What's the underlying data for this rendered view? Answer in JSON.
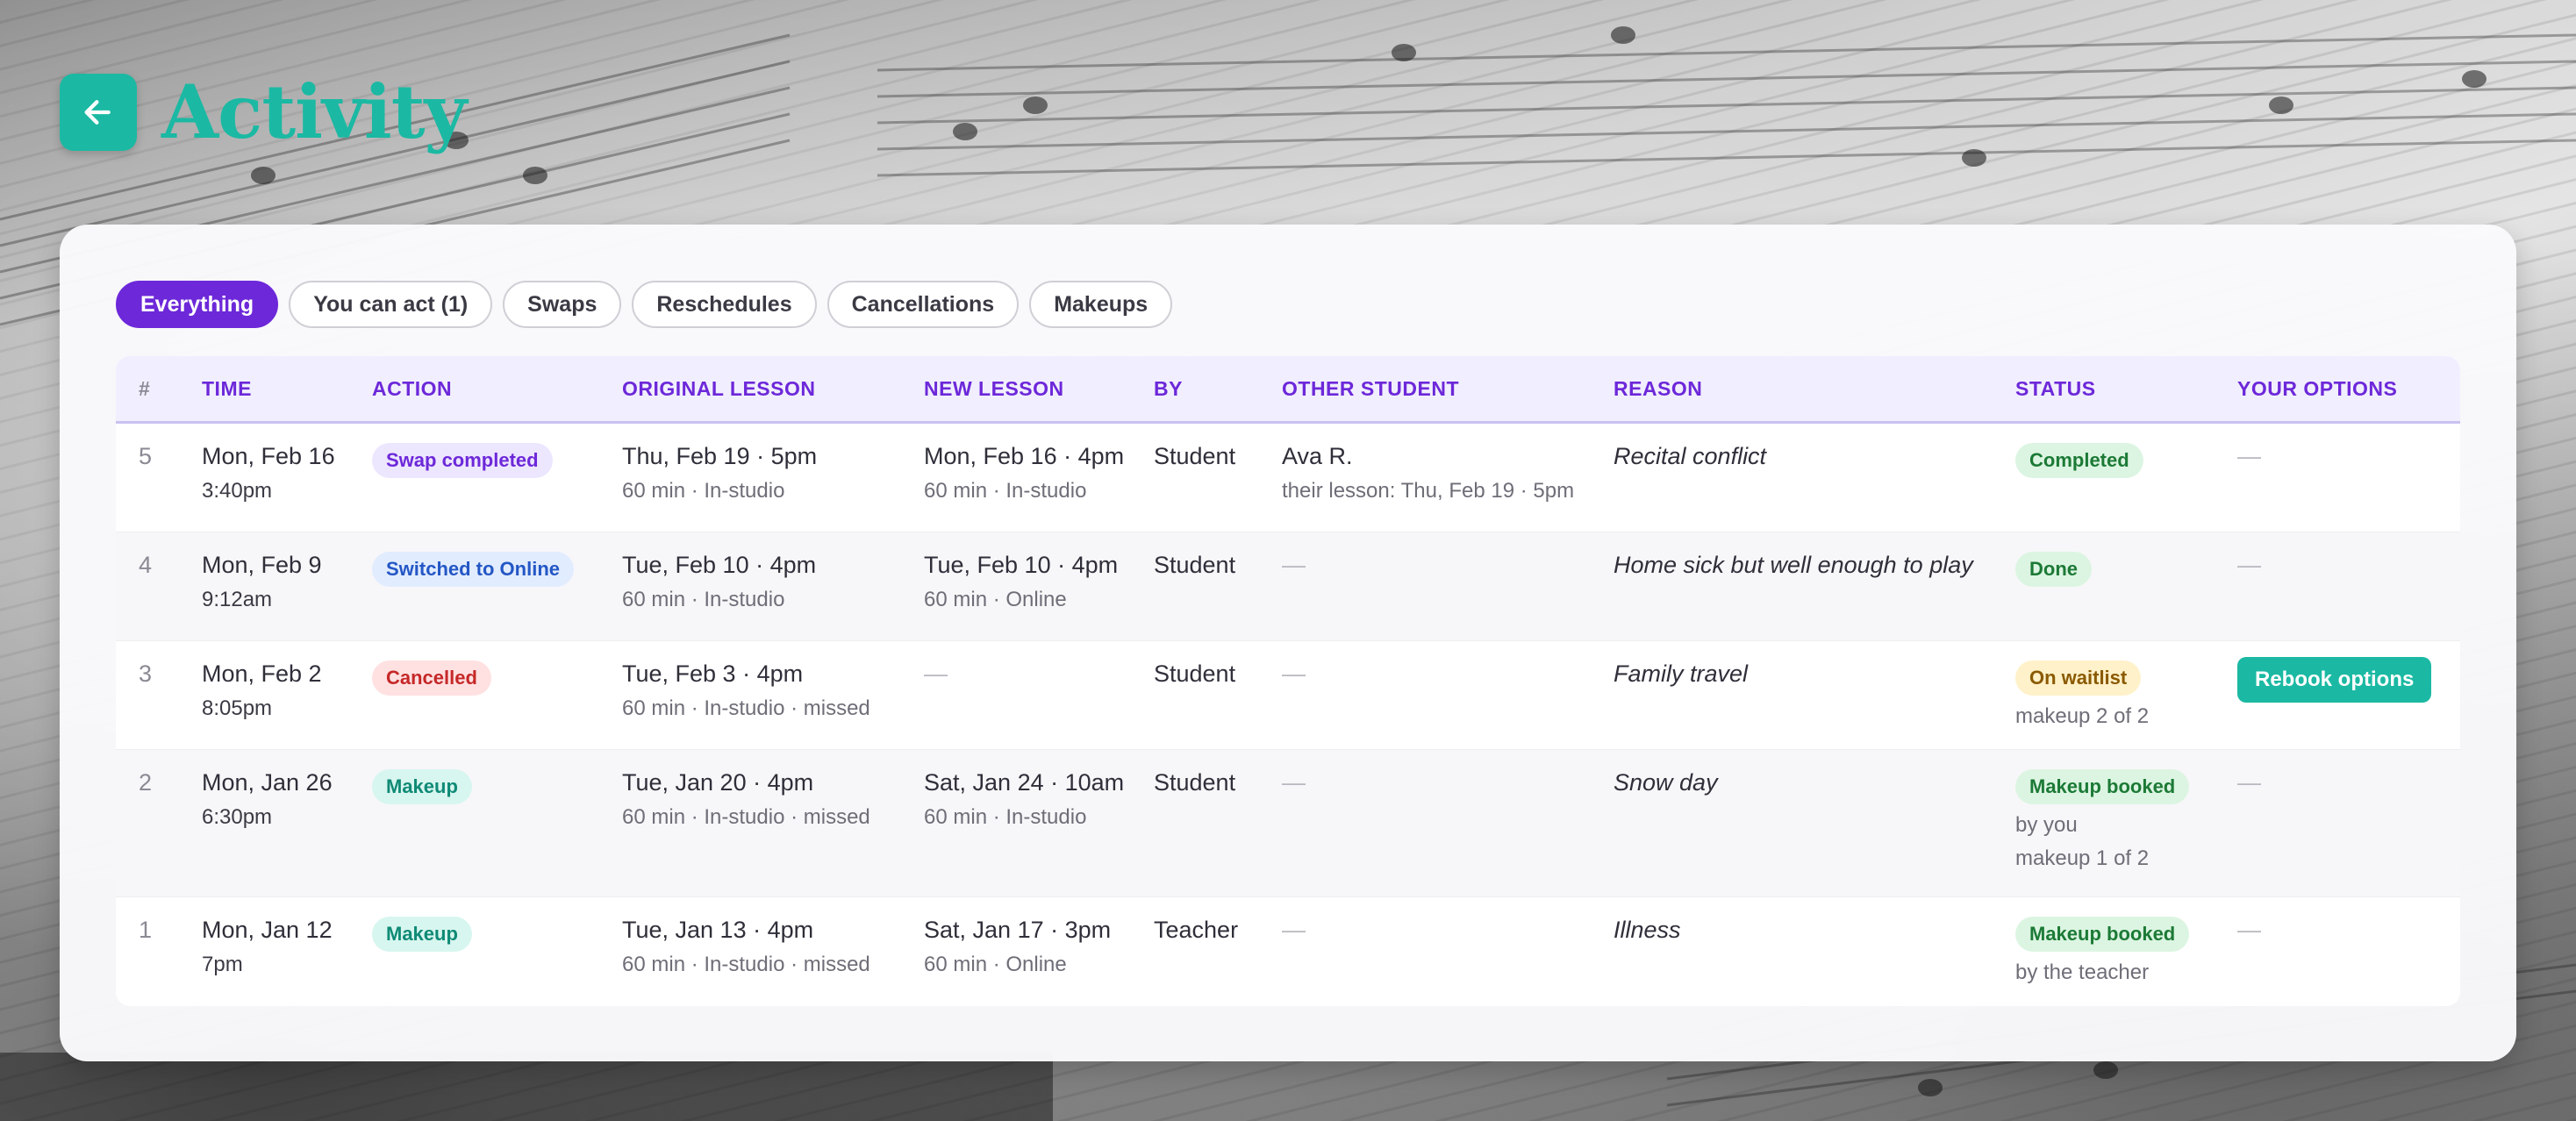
{
  "header": {
    "title": "Activity"
  },
  "filters": [
    "Everything",
    "You can act (1)",
    "Swaps",
    "Reschedules",
    "Cancellations",
    "Makeups"
  ],
  "columns": [
    "#",
    "TIME",
    "ACTION",
    "ORIGINAL LESSON",
    "NEW LESSON",
    "BY",
    "OTHER STUDENT",
    "REASON",
    "STATUS",
    "YOUR OPTIONS"
  ],
  "rows": [
    {
      "num": "5",
      "date": "Mon, Feb 16",
      "time": "3:40pm",
      "action": "Swap completed",
      "orig": "Thu, Feb 19 · 5pm",
      "orig_sub": "60 min · In-studio",
      "new": "Mon, Feb 16 · 4pm",
      "new_sub": "60 min · In-studio",
      "by": "Student",
      "other": "Ava R.",
      "other_sub": "their lesson: Thu, Feb 19 · 5pm",
      "reason": "Recital conflict",
      "status": "Completed",
      "status_sub1": "",
      "status_sub2": "",
      "options": "—"
    },
    {
      "num": "4",
      "date": "Mon, Feb 9",
      "time": "9:12am",
      "action": "Switched to Online",
      "orig": "Tue, Feb 10 · 4pm",
      "orig_sub": "60 min · In-studio",
      "new": "Tue, Feb 10 · 4pm",
      "new_sub": "60 min · Online",
      "by": "Student",
      "other": "—",
      "other_sub": "",
      "reason": "Home sick but well enough to play",
      "status": "Done",
      "status_sub1": "",
      "status_sub2": "",
      "options": "—"
    },
    {
      "num": "3",
      "date": "Mon, Feb 2",
      "time": "8:05pm",
      "action": "Cancelled",
      "orig": "Tue, Feb 3 · 4pm",
      "orig_sub": "60 min · In-studio · missed",
      "new": "—",
      "new_sub": "",
      "by": "Student",
      "other": "—",
      "other_sub": "",
      "reason": "Family travel",
      "status": "On waitlist",
      "status_sub1": "makeup 2 of 2",
      "status_sub2": "",
      "options": "Rebook options"
    },
    {
      "num": "2",
      "date": "Mon, Jan 26",
      "time": "6:30pm",
      "action": "Makeup",
      "orig": "Tue, Jan 20 · 4pm",
      "orig_sub": "60 min · In-studio · missed",
      "new": "Sat, Jan 24 · 10am",
      "new_sub": "60 min · In-studio",
      "by": "Student",
      "other": "—",
      "other_sub": "",
      "reason": "Snow day",
      "status": "Makeup booked",
      "status_sub1": "by you",
      "status_sub2": "makeup 1 of 2",
      "options": "—"
    },
    {
      "num": "1",
      "date": "Mon, Jan 12",
      "time": "7pm",
      "action": "Makeup",
      "orig": "Tue, Jan 13 · 4pm",
      "orig_sub": "60 min · In-studio · missed",
      "new": "Sat, Jan 17 · 3pm",
      "new_sub": "60 min · Online",
      "by": "Teacher",
      "other": "—",
      "other_sub": "",
      "reason": "Illness",
      "status": "Makeup booked",
      "status_sub1": "by the teacher",
      "status_sub2": "",
      "options": "—"
    }
  ],
  "colors": {
    "accent": "#6d28d9",
    "teal": "#1bb9a3"
  }
}
